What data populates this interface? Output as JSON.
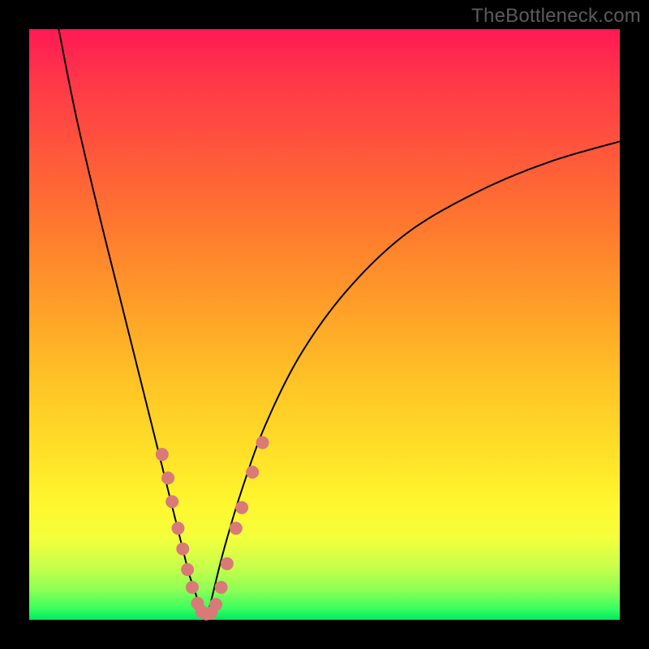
{
  "watermark": "TheBottleneck.com",
  "chart_data": {
    "type": "line",
    "title": "",
    "xlabel": "",
    "ylabel": "",
    "xlim": [
      0,
      100
    ],
    "ylim": [
      0,
      100
    ],
    "grid": false,
    "curve_left": {
      "x": [
        5,
        8,
        12,
        16,
        20,
        22,
        24,
        26,
        27,
        28,
        29,
        30
      ],
      "y": [
        100,
        85,
        68,
        52,
        36,
        28,
        20,
        12,
        8,
        5,
        2,
        0
      ]
    },
    "curve_right": {
      "x": [
        30,
        31,
        33,
        36,
        40,
        46,
        54,
        64,
        76,
        88,
        100
      ],
      "y": [
        0,
        4,
        12,
        22,
        33,
        45,
        56,
        65.5,
        72.5,
        77.5,
        81
      ]
    },
    "markers": [
      {
        "x": 22.5,
        "y": 28
      },
      {
        "x": 23.5,
        "y": 24
      },
      {
        "x": 24.2,
        "y": 20
      },
      {
        "x": 25.2,
        "y": 15.5
      },
      {
        "x": 26.0,
        "y": 12
      },
      {
        "x": 26.8,
        "y": 8.5
      },
      {
        "x": 27.6,
        "y": 5.5
      },
      {
        "x": 28.5,
        "y": 2.8
      },
      {
        "x": 29.2,
        "y": 1.4
      },
      {
        "x": 30.0,
        "y": 1.0
      },
      {
        "x": 30.8,
        "y": 1.2
      },
      {
        "x": 31.6,
        "y": 2.6
      },
      {
        "x": 32.5,
        "y": 5.5
      },
      {
        "x": 33.5,
        "y": 9.5
      },
      {
        "x": 35.0,
        "y": 15.5
      },
      {
        "x": 36.0,
        "y": 19
      },
      {
        "x": 37.8,
        "y": 25
      },
      {
        "x": 39.5,
        "y": 30
      }
    ],
    "marker_color": "#d97a78"
  }
}
